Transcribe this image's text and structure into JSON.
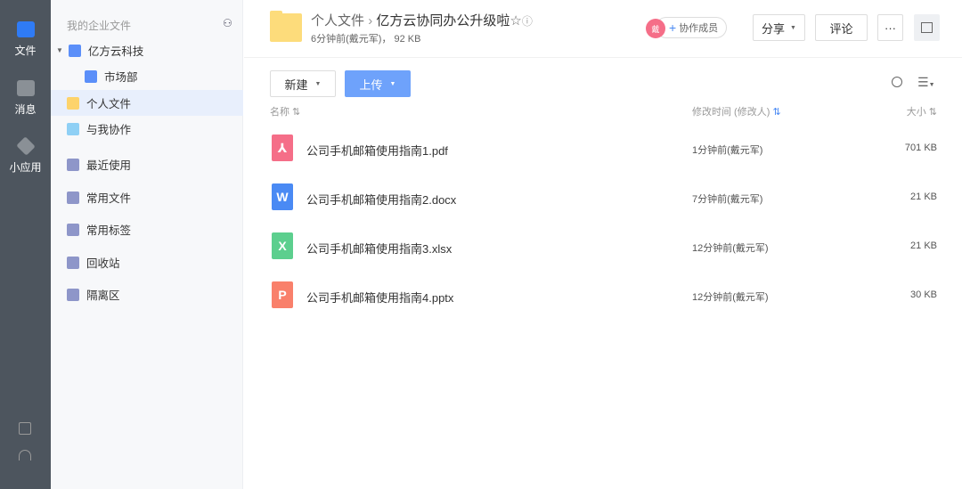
{
  "rail": {
    "items": [
      {
        "label": "文件"
      },
      {
        "label": "消息"
      },
      {
        "label": "小应用"
      }
    ]
  },
  "sidebar": {
    "title": "我的企业文件",
    "company": "亿方云科技",
    "dept": "市场部",
    "items": [
      {
        "label": "个人文件"
      },
      {
        "label": "与我协作"
      },
      {
        "label": "最近使用"
      },
      {
        "label": "常用文件"
      },
      {
        "label": "常用标签"
      },
      {
        "label": "回收站"
      },
      {
        "label": "隔离区"
      }
    ]
  },
  "header": {
    "crumb_parent": "个人文件",
    "sep": "›",
    "title": "亿方云协同办公升级啦",
    "meta": "6分钟前(戴元军)，  92 KB",
    "avatar": "戴",
    "collab": "协作成员",
    "share": "分享",
    "comment": "评论",
    "more": "···"
  },
  "toolbar": {
    "new": "新建",
    "upload": "上传"
  },
  "columns": {
    "name": "名称",
    "time": "修改时间 (修改人)",
    "size": "大小"
  },
  "files": [
    {
      "icon": "",
      "color": "#f56e88",
      "name": "公司手机邮箱使用指南1.pdf",
      "time": "1分钟前(戴元军)",
      "size": "701 KB"
    },
    {
      "icon": "W",
      "color": "#4a8af4",
      "name": "公司手机邮箱使用指南2.docx",
      "time": "7分钟前(戴元军)",
      "size": "21 KB"
    },
    {
      "icon": "X",
      "color": "#5ccf8e",
      "name": "公司手机邮箱使用指南3.xlsx",
      "time": "12分钟前(戴元军)",
      "size": "21 KB"
    },
    {
      "icon": "P",
      "color": "#f9806b",
      "name": "公司手机邮箱使用指南4.pptx",
      "time": "12分钟前(戴元军)",
      "size": "30 KB"
    }
  ]
}
